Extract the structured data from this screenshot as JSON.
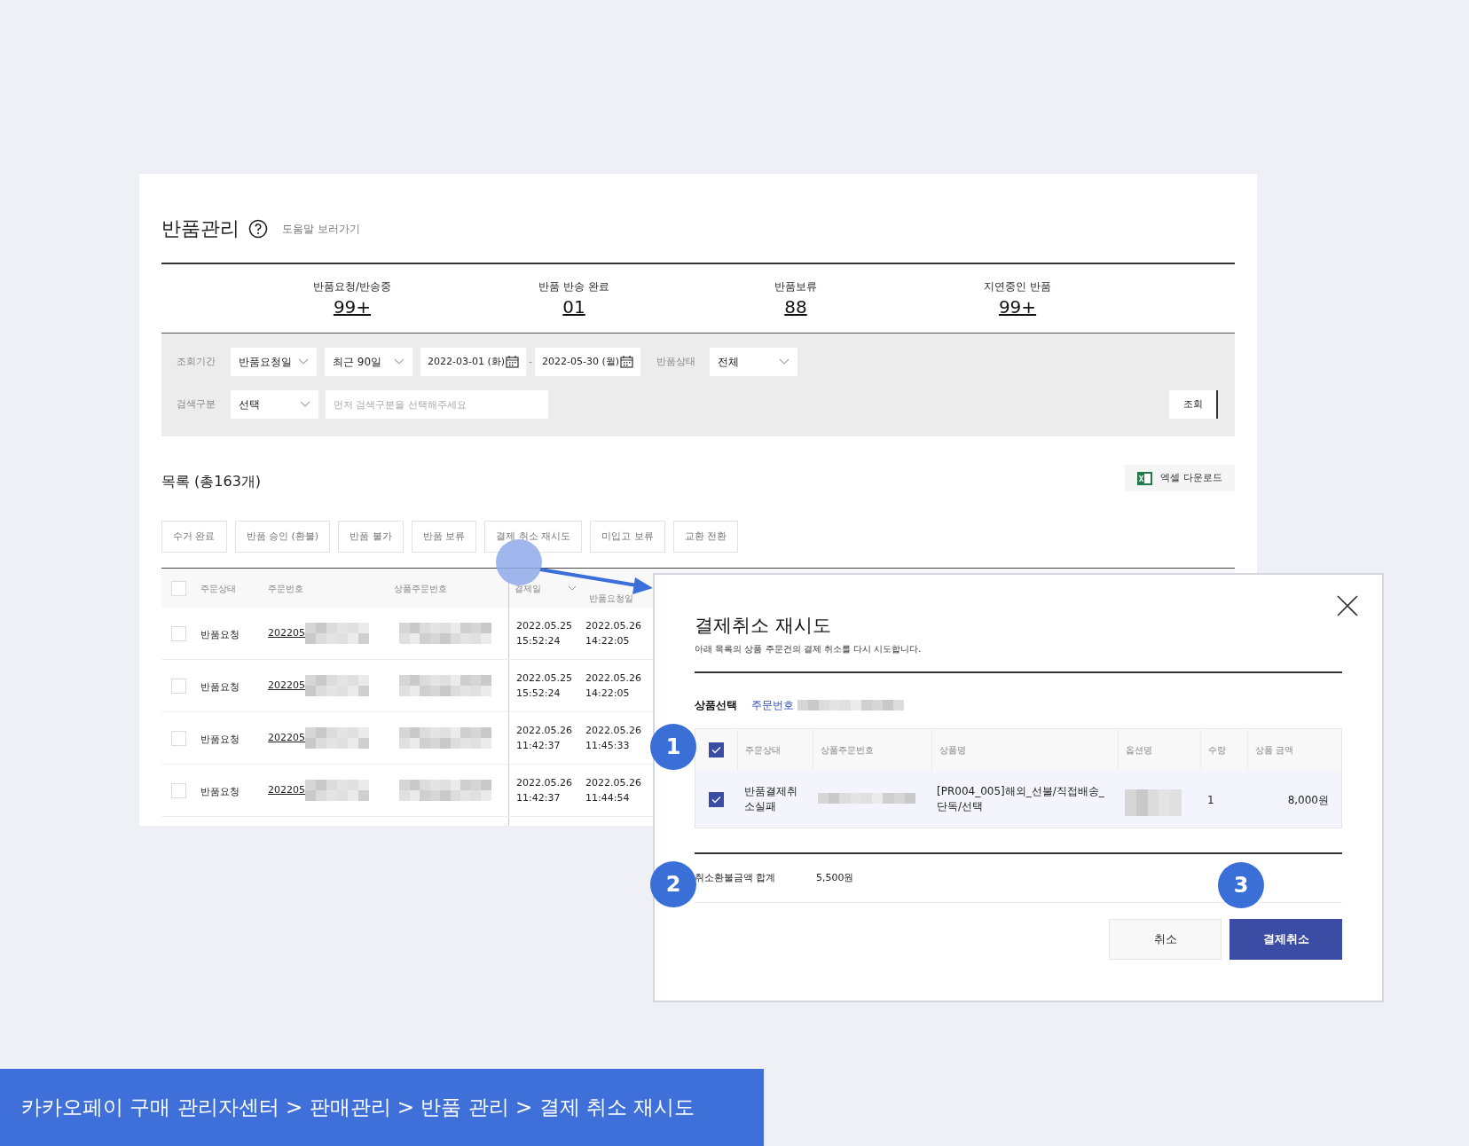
{
  "page": {
    "title": "반품관리",
    "help_link": "도움말 보러가기"
  },
  "stats": [
    {
      "label": "반품요청/반송중",
      "value": "99+"
    },
    {
      "label": "반품 반송 완료",
      "value": "01"
    },
    {
      "label": "반품보류",
      "value": "88"
    },
    {
      "label": "지연중인 반품",
      "value": "99+"
    }
  ],
  "filters": {
    "period_label": "조회기간",
    "date_type": "반품요청일",
    "range": "최근 90일",
    "start_date": "2022-03-01 (화)",
    "separator": "-",
    "end_date": "2022-05-30 (월)",
    "status_label": "반품상태",
    "status": "전체",
    "search_label": "검색구분",
    "search_type": "선택",
    "search_placeholder": "먼저 검색구분을 선택해주세요",
    "search_button": "조회"
  },
  "list": {
    "title": "목록 (총163개)",
    "excel_button": "엑셀 다운로드",
    "actions": [
      "수거 완료",
      "반품 승인 (환불)",
      "반품 불가",
      "반품 보류",
      "결제 취소 재시도",
      "미입고 보류",
      "교환 전환"
    ],
    "columns": [
      "주문상태",
      "주문번호",
      "상품주문번호",
      "결제일",
      "반품요청일"
    ],
    "header_checked": false,
    "rows": [
      {
        "checked": false,
        "status": "반품요청",
        "order_no": "202205",
        "masked": true,
        "paid_date": "2022.05.25",
        "paid_time": "15:52:24",
        "request_date": "2022.05.26",
        "request_time": "14:22:05"
      },
      {
        "checked": false,
        "status": "반품요청",
        "order_no": "202205",
        "masked": true,
        "paid_date": "2022.05.25",
        "paid_time": "15:52:24",
        "request_date": "2022.05.26",
        "request_time": "14:22:05"
      },
      {
        "checked": false,
        "status": "반품요청",
        "order_no": "202205",
        "masked": true,
        "paid_date": "2022.05.26",
        "paid_time": "11:42:37",
        "request_date": "2022.05.26",
        "request_time": "11:45:33"
      },
      {
        "checked": false,
        "status": "반품요청",
        "order_no": "202205",
        "masked": true,
        "paid_date": "2022.05.26",
        "paid_time": "11:42:37",
        "request_date": "2022.05.26",
        "request_time": "11:44:54"
      }
    ]
  },
  "modal": {
    "title": "결제취소 재시도",
    "description": "아래 목록의 상품 주문건의 결제 취소를 다시 시도합니다.",
    "select_label": "상품선택",
    "order_label": "주문번호",
    "header_checked": true,
    "columns": [
      "주문상태",
      "상품주문번호",
      "상품명",
      "옵션명",
      "수량",
      "상품 금액"
    ],
    "rows": [
      {
        "checked": true,
        "status": "반품결제취소실패",
        "product": "[PR004_005]해외_선불/직접배송_단독/선택",
        "quantity": "1",
        "amount": "8,000원"
      }
    ],
    "total_label": "취소환불금액 합계",
    "total": "5,500원",
    "buttons": [
      {
        "label": "취소",
        "kind": "secondary"
      },
      {
        "label": "결제취소",
        "kind": "primary"
      }
    ]
  },
  "steps": [
    {
      "number": "1"
    },
    {
      "number": "2"
    },
    {
      "number": "3"
    }
  ],
  "breadcrumb": "카카오페이 구매 관리자센터 > 판매관리 > 반품 관리 > 결제 취소 재시도"
}
